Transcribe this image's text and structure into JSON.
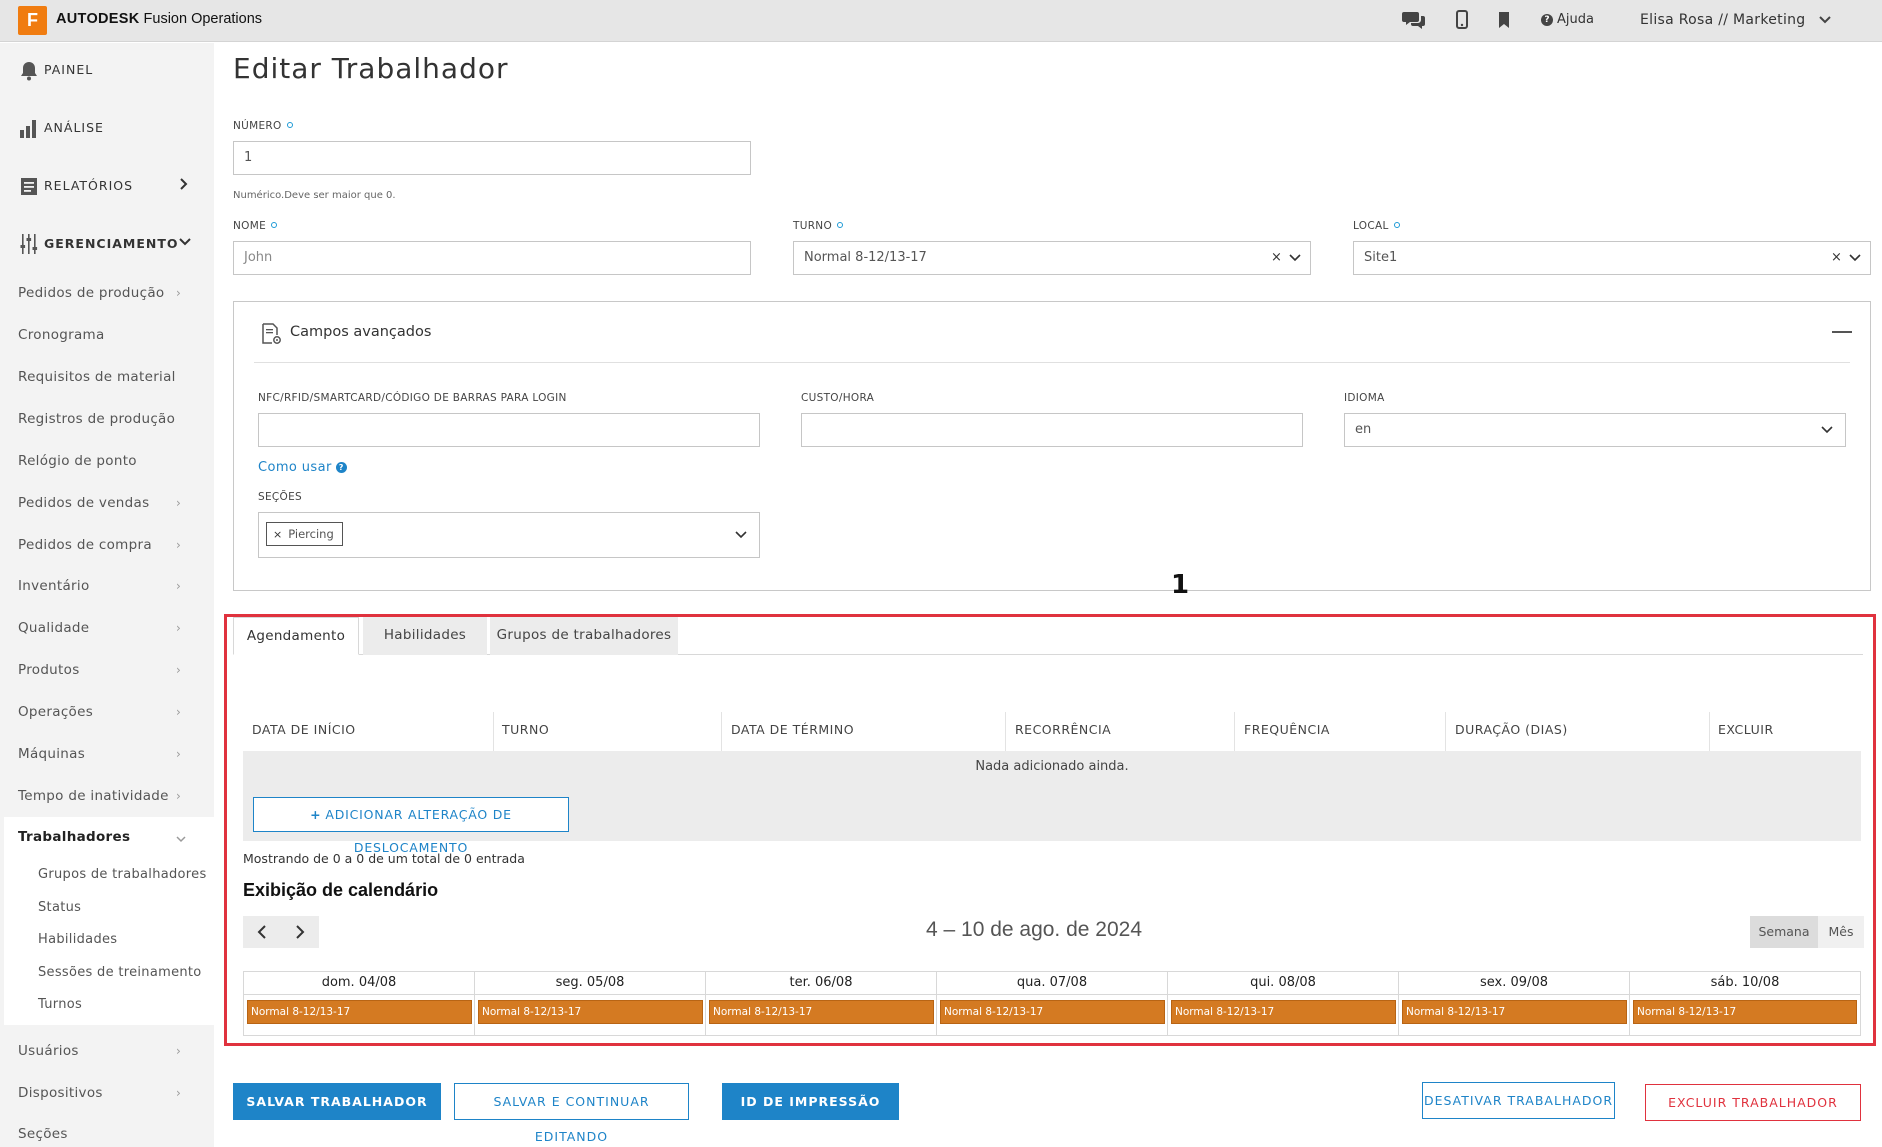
{
  "app": {
    "logo_letter": "F",
    "brand_bold": "AUTODESK",
    "brand_rest": " Fusion Operations",
    "help_label": "Ajuda",
    "user_label": "Elisa Rosa // Marketing"
  },
  "sidebar": {
    "top": [
      {
        "label": "PAINEL"
      },
      {
        "label": "ANÁLISE"
      },
      {
        "label": "RELATÓRIOS"
      },
      {
        "label": "GERENCIAMENTO"
      }
    ],
    "items": [
      {
        "label": "Pedidos de produção",
        "arrow": "›"
      },
      {
        "label": "Cronograma"
      },
      {
        "label": "Requisitos de material"
      },
      {
        "label": "Registros de produção"
      },
      {
        "label": "Relógio de ponto"
      },
      {
        "label": "Pedidos de vendas",
        "arrow": "›"
      },
      {
        "label": "Pedidos de compra",
        "arrow": "›"
      },
      {
        "label": "Inventário",
        "arrow": "›"
      },
      {
        "label": "Qualidade",
        "arrow": "›"
      },
      {
        "label": "Produtos",
        "arrow": "›"
      },
      {
        "label": "Operações",
        "arrow": "›"
      },
      {
        "label": "Máquinas",
        "arrow": "›"
      },
      {
        "label": "Tempo de inatividade",
        "arrow": "›"
      },
      {
        "label": "Trabalhadores"
      }
    ],
    "sub_items": [
      {
        "label": "Grupos de trabalhadores"
      },
      {
        "label": "Status"
      },
      {
        "label": "Habilidades"
      },
      {
        "label": "Sessões de treinamento"
      },
      {
        "label": "Turnos"
      }
    ],
    "bottom_items": [
      {
        "label": "Usuários",
        "arrow": "›"
      },
      {
        "label": "Dispositivos",
        "arrow": "›"
      },
      {
        "label": "Seções"
      }
    ]
  },
  "form": {
    "title": "Editar Trabalhador",
    "numero": {
      "label": "NÚMERO",
      "value": "1",
      "hint": "Numérico.Deve ser maior que 0."
    },
    "nome": {
      "label": "NOME",
      "placeholder": "John"
    },
    "turno": {
      "label": "TURNO",
      "value": "Normal 8-12/13-17",
      "clear": "×"
    },
    "local": {
      "label": "LOCAL",
      "value": "Site1",
      "clear": "×"
    }
  },
  "advanced": {
    "title": "Campos avançados",
    "nfc": {
      "label": "NFC/RFID/SMARTCARD/CÓDIGO DE BARRAS PARA LOGIN",
      "value": ""
    },
    "custo": {
      "label": "CUSTO/HORA",
      "value": ""
    },
    "idioma": {
      "label": "IDIOMA",
      "value": "en"
    },
    "how_to": "Como usar",
    "secoes": {
      "label": "SEÇÕES",
      "tags": [
        "Piercing"
      ]
    }
  },
  "annotation": {
    "number": "1",
    "color": "#e0323e"
  },
  "tabs": [
    {
      "label": "Agendamento",
      "active": true
    },
    {
      "label": "Habilidades",
      "active": false
    },
    {
      "label": "Grupos de trabalhadores",
      "active": false
    }
  ],
  "schedule_table": {
    "columns": [
      "DATA DE INÍCIO",
      "TURNO",
      "DATA DE TÉRMINO",
      "RECORRÊNCIA",
      "FREQUÊNCIA",
      "DURAÇÃO (DIAS)",
      "EXCLUIR"
    ],
    "empty_text": "Nada adicionado ainda.",
    "add_button": "ADICIONAR ALTERAÇÃO DE DESLOCAMENTO",
    "showing": "Mostrando de 0 a 0 de um total de 0 entrada"
  },
  "calendar": {
    "title": "Exibição de calendário",
    "range": "4 – 10 de ago. de 2024",
    "views": [
      "Semana",
      "Mês"
    ],
    "active_view": "Semana",
    "days": [
      {
        "header": "dom. 04/08",
        "event": "Normal 8-12/13-17"
      },
      {
        "header": "seg. 05/08",
        "event": "Normal 8-12/13-17"
      },
      {
        "header": "ter. 06/08",
        "event": "Normal 8-12/13-17"
      },
      {
        "header": "qua. 07/08",
        "event": "Normal 8-12/13-17"
      },
      {
        "header": "qui. 08/08",
        "event": "Normal 8-12/13-17"
      },
      {
        "header": "sex. 09/08",
        "event": "Normal 8-12/13-17"
      },
      {
        "header": "sáb. 10/08",
        "event": "Normal 8-12/13-17"
      }
    ],
    "event_color": "#d47a22"
  },
  "actions": {
    "save": "SALVAR TRABALHADOR",
    "save_continue": "SALVAR E CONTINUAR EDITANDO",
    "print_id": "ID DE IMPRESSÃO",
    "deactivate": "DESATIVAR TRABALHADOR",
    "delete": "EXCLUIR TRABALHADOR"
  },
  "colors": {
    "accent": "#1e84c8",
    "brand": "#f07c10",
    "danger": "#e0323e"
  }
}
